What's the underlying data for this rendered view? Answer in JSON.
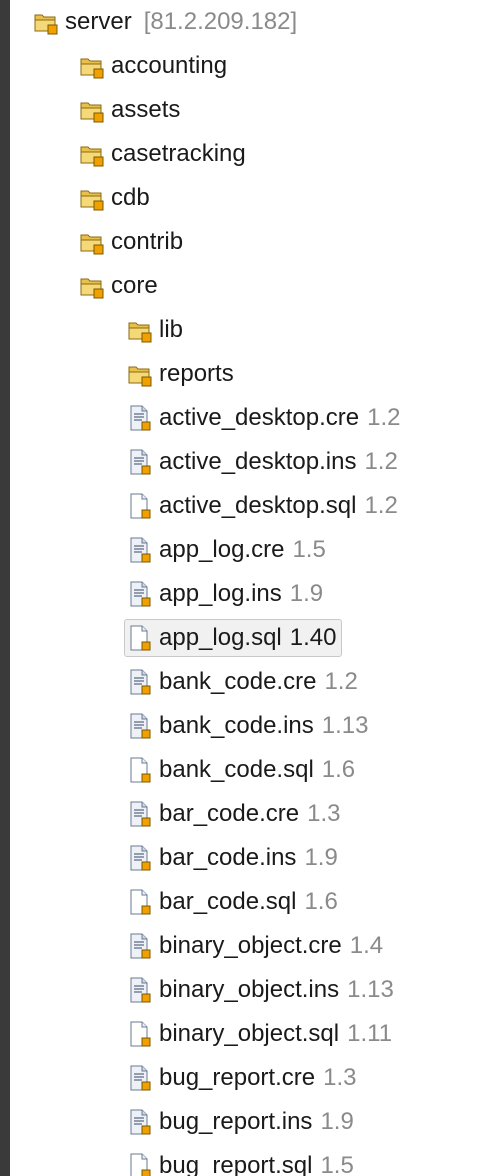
{
  "tree": {
    "root": {
      "label": "server",
      "host": "[81.2.209.182]",
      "icon": "shared-project-folder-icon"
    },
    "folders": [
      {
        "label": "accounting",
        "icon": "shared-folder-icon"
      },
      {
        "label": "assets",
        "icon": "shared-folder-icon"
      },
      {
        "label": "casetracking",
        "icon": "shared-folder-icon"
      },
      {
        "label": "cdb",
        "icon": "shared-folder-icon"
      },
      {
        "label": "contrib",
        "icon": "shared-folder-icon"
      },
      {
        "label": "core",
        "icon": "shared-folder-icon"
      }
    ],
    "core_children": [
      {
        "label": "lib",
        "type": "folder",
        "icon": "shared-folder-icon"
      },
      {
        "label": "reports",
        "type": "folder",
        "icon": "shared-folder-icon"
      },
      {
        "label": "active_desktop.cre",
        "rev": "1.2",
        "type": "text",
        "icon": "text-file-icon"
      },
      {
        "label": "active_desktop.ins",
        "rev": "1.2",
        "type": "text",
        "icon": "text-file-icon"
      },
      {
        "label": "active_desktop.sql",
        "rev": "1.2",
        "type": "blank",
        "icon": "blank-file-icon"
      },
      {
        "label": "app_log.cre",
        "rev": "1.5",
        "type": "text",
        "icon": "text-file-icon"
      },
      {
        "label": "app_log.ins",
        "rev": "1.9",
        "type": "text",
        "icon": "text-file-icon"
      },
      {
        "label": "app_log.sql",
        "rev": "1.40",
        "type": "blank",
        "icon": "blank-file-icon",
        "selected": true
      },
      {
        "label": "bank_code.cre",
        "rev": "1.2",
        "type": "text",
        "icon": "text-file-icon"
      },
      {
        "label": "bank_code.ins",
        "rev": "1.13",
        "type": "text",
        "icon": "text-file-icon"
      },
      {
        "label": "bank_code.sql",
        "rev": "1.6",
        "type": "blank",
        "icon": "blank-file-icon"
      },
      {
        "label": "bar_code.cre",
        "rev": "1.3",
        "type": "text",
        "icon": "text-file-icon"
      },
      {
        "label": "bar_code.ins",
        "rev": "1.9",
        "type": "text",
        "icon": "text-file-icon"
      },
      {
        "label": "bar_code.sql",
        "rev": "1.6",
        "type": "blank",
        "icon": "blank-file-icon"
      },
      {
        "label": "binary_object.cre",
        "rev": "1.4",
        "type": "text",
        "icon": "text-file-icon"
      },
      {
        "label": "binary_object.ins",
        "rev": "1.13",
        "type": "text",
        "icon": "text-file-icon"
      },
      {
        "label": "binary_object.sql",
        "rev": "1.11",
        "type": "blank",
        "icon": "blank-file-icon"
      },
      {
        "label": "bug_report.cre",
        "rev": "1.3",
        "type": "text",
        "icon": "text-file-icon"
      },
      {
        "label": "bug_report.ins",
        "rev": "1.9",
        "type": "text",
        "icon": "text-file-icon"
      },
      {
        "label": "bug_report.sql",
        "rev": "1.5",
        "type": "blank",
        "icon": "blank-file-icon"
      }
    ]
  },
  "colors": {
    "folder_yellow": "#e8c04a",
    "cvs_badge": "#f0a000",
    "text_dark": "#1a1a1a",
    "revision_gray": "#8a8a8a"
  }
}
